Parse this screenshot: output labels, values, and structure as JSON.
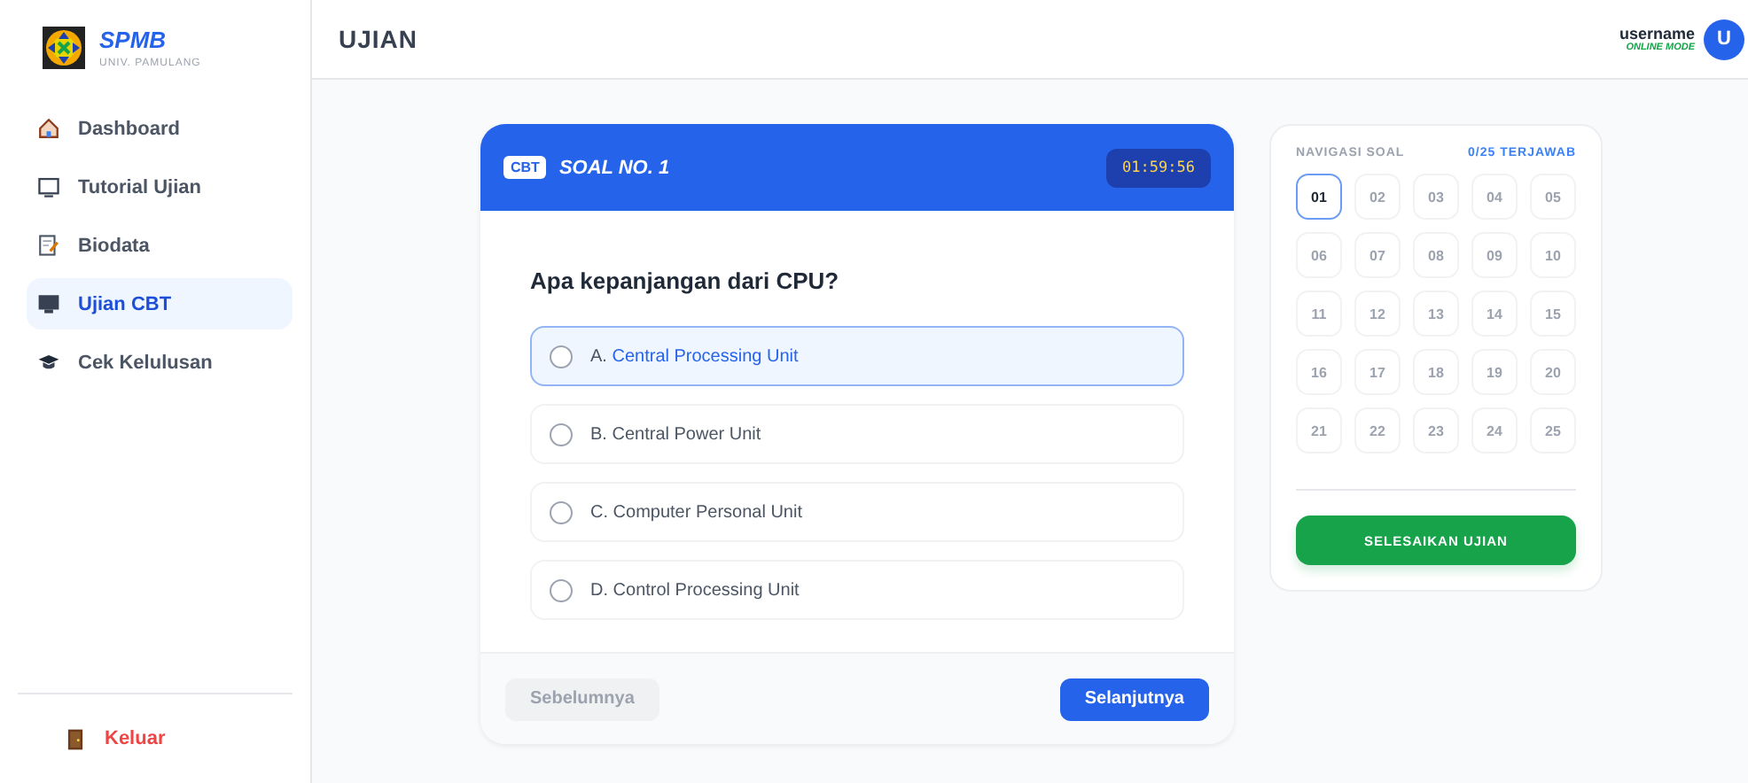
{
  "brand": {
    "title": "SPMB",
    "subtitle": "UNIV. PAMULANG"
  },
  "sidebar": {
    "items": [
      {
        "label": "Dashboard",
        "kind": "house",
        "selected": false
      },
      {
        "label": "Tutorial Ujian",
        "kind": "screen",
        "selected": false
      },
      {
        "label": "Biodata",
        "kind": "note",
        "selected": false
      },
      {
        "label": "Ujian CBT",
        "kind": "monitor",
        "selected": true
      },
      {
        "label": "Cek Kelulusan",
        "kind": "cap",
        "selected": false
      }
    ],
    "logout": "Keluar"
  },
  "header": {
    "title": "UJIAN",
    "user": "username",
    "status": "ONLINE MODE",
    "avatar": "U"
  },
  "question": {
    "badge": "CBT",
    "title": "SOAL NO. 1",
    "timer": "01:59:56",
    "text": "Apa kepanjangan dari CPU?",
    "options": [
      {
        "letter": "A.",
        "text": "Central Processing Unit",
        "highlighted": true,
        "selected": false
      },
      {
        "letter": "B.",
        "text": "Central Power Unit",
        "highlighted": false,
        "selected": false
      },
      {
        "letter": "C.",
        "text": "Computer Personal Unit",
        "highlighted": false,
        "selected": false
      },
      {
        "letter": "D.",
        "text": "Control Processing Unit",
        "highlighted": false,
        "selected": false
      }
    ],
    "prev": {
      "label": "Sebelumnya",
      "disabled": true
    },
    "next": {
      "label": "Selanjutnya",
      "disabled": false
    }
  },
  "navigation": {
    "title": "NAVIGASI SOAL",
    "progress": "0/25 TERJAWAB",
    "numbers": [
      {
        "label": "01",
        "selected": true
      },
      {
        "label": "02",
        "selected": false
      },
      {
        "label": "03",
        "selected": false
      },
      {
        "label": "04",
        "selected": false
      },
      {
        "label": "05",
        "selected": false
      },
      {
        "label": "06",
        "selected": false
      },
      {
        "label": "07",
        "selected": false
      },
      {
        "label": "08",
        "selected": false
      },
      {
        "label": "09",
        "selected": false
      },
      {
        "label": "10",
        "selected": false
      },
      {
        "label": "11",
        "selected": false
      },
      {
        "label": "12",
        "selected": false
      },
      {
        "label": "13",
        "selected": false
      },
      {
        "label": "14",
        "selected": false
      },
      {
        "label": "15",
        "selected": false
      },
      {
        "label": "16",
        "selected": false
      },
      {
        "label": "17",
        "selected": false
      },
      {
        "label": "18",
        "selected": false
      },
      {
        "label": "19",
        "selected": false
      },
      {
        "label": "20",
        "selected": false
      },
      {
        "label": "21",
        "selected": false
      },
      {
        "label": "22",
        "selected": false
      },
      {
        "label": "23",
        "selected": false
      },
      {
        "label": "24",
        "selected": false
      },
      {
        "label": "25",
        "selected": false
      }
    ],
    "finish": "SELESAIKAN UJIAN"
  }
}
